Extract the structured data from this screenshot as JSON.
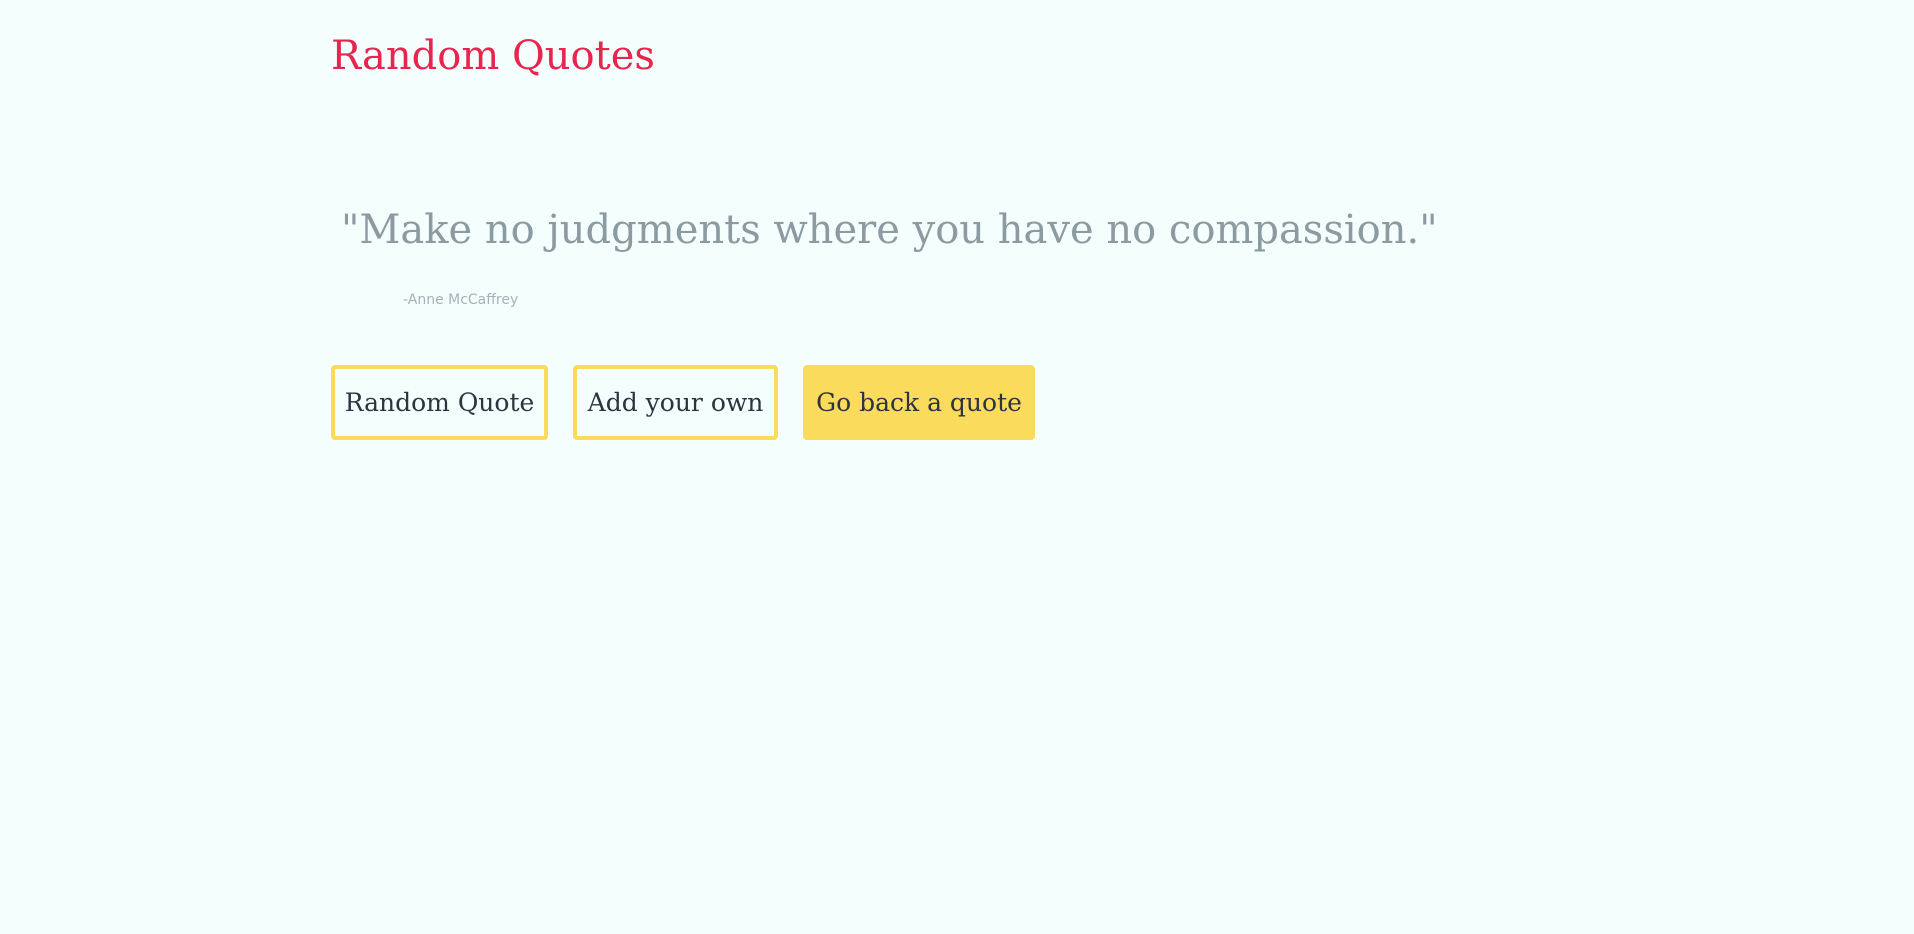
{
  "header": {
    "title": "Random Quotes"
  },
  "quote": {
    "text": "\"Make no judgments where you have no compassion.\"",
    "author": "-Anne McCaffrey"
  },
  "actions": {
    "random_label": "Random Quote",
    "add_label": "Add your own",
    "back_label": "Go back a quote"
  },
  "colors": {
    "background": "#f4fffd",
    "title": "#e8254f",
    "quote_text": "#8c9ba1",
    "author": "#a6b2b7",
    "button_accent": "#fbdb5c",
    "button_text": "#2b3440"
  }
}
